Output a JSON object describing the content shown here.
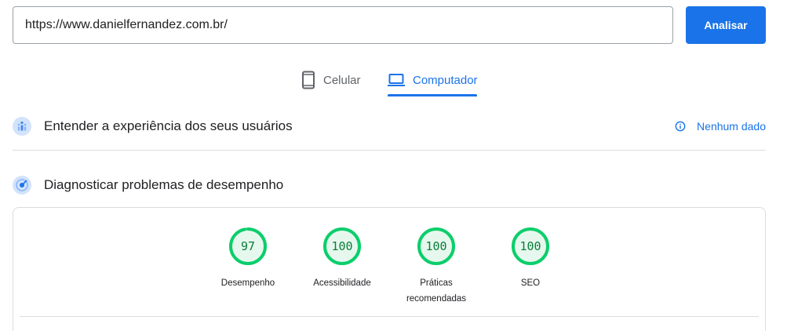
{
  "url_input": {
    "value": "https://www.danielfernandez.com.br/"
  },
  "analyze_button": {
    "label": "Analisar"
  },
  "tabs": [
    {
      "label": "Celular",
      "icon": "smartphone-icon",
      "selected": false
    },
    {
      "label": "Computador",
      "icon": "laptop-icon",
      "selected": true
    }
  ],
  "field_data": {
    "title": "Entender a experiência dos seus usuários",
    "status_label": "Nenhum dado",
    "status_icon": "info-icon"
  },
  "lab_data": {
    "title": "Diagnosticar problemas de desempenho",
    "scores": [
      {
        "value": 97,
        "label": "Desempenho"
      },
      {
        "value": 100,
        "label": "Acessibilidade"
      },
      {
        "value": 100,
        "label": "Práticas recomendadas"
      },
      {
        "value": 100,
        "label": "SEO"
      }
    ]
  },
  "colors": {
    "accent": "#1a73e8",
    "score_good": "#0cce6b",
    "score_good_text": "#0a7d38",
    "score_good_fill": "#e6f8ee"
  }
}
